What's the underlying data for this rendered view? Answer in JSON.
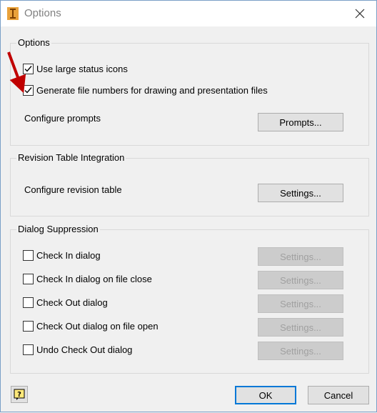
{
  "window": {
    "title": "Options"
  },
  "options_group": {
    "label": "Options",
    "use_large_status_icons": {
      "label": "Use large status icons",
      "checked": true
    },
    "generate_file_numbers": {
      "label": "Generate file numbers for drawing and presentation files",
      "checked": true
    },
    "configure_prompts_label": "Configure prompts",
    "prompts_button": "Prompts..."
  },
  "revision_group": {
    "label": "Revision Table Integration",
    "configure_label": "Configure revision table",
    "settings_button": "Settings..."
  },
  "suppression_group": {
    "label": "Dialog Suppression",
    "items": [
      {
        "label": "Check In dialog",
        "checked": false,
        "button": "Settings..."
      },
      {
        "label": "Check In dialog on file close",
        "checked": false,
        "button": "Settings..."
      },
      {
        "label": "Check Out dialog",
        "checked": false,
        "button": "Settings..."
      },
      {
        "label": "Check Out dialog on file open",
        "checked": false,
        "button": "Settings..."
      },
      {
        "label": "Undo Check Out dialog",
        "checked": false,
        "button": "Settings..."
      }
    ]
  },
  "footer": {
    "ok": "OK",
    "cancel": "Cancel"
  },
  "colors": {
    "accent": "#0078d7",
    "arrow": "#c00000"
  }
}
